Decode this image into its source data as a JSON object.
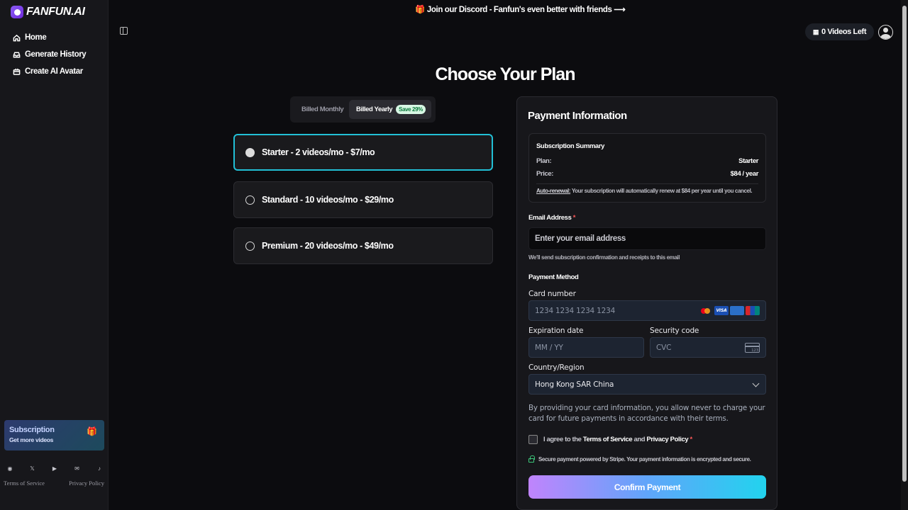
{
  "sidebar": {
    "logo": "FANFUN.AI",
    "items": [
      {
        "label": "Home",
        "icon": "home-icon"
      },
      {
        "label": "Generate History",
        "icon": "inbox-icon"
      },
      {
        "label": "Create AI Avatar",
        "icon": "film-icon"
      }
    ],
    "subscription": {
      "title": "Subscription",
      "subtitle": "Get more videos",
      "icon": "gift-icon"
    },
    "socials": [
      "discord-icon",
      "x-icon",
      "youtube-icon",
      "mail-icon",
      "tiktok-icon"
    ],
    "footer": {
      "terms": "Terms of Service",
      "privacy": "Privacy Policy"
    }
  },
  "header": {
    "banner": "Join our Discord - Fanfun's even better with friends ⟶",
    "videos_left": "0 Videos Left"
  },
  "main": {
    "title": "Choose Your Plan",
    "billing": {
      "monthly": "Billed Monthly",
      "yearly": "Billed Yearly",
      "save_badge": "Save 29%",
      "selected": "yearly"
    },
    "plans": [
      {
        "label": "Starter - 2 videos/mo - $7/mo",
        "selected": true
      },
      {
        "label": "Standard - 10 videos/mo - $29/mo",
        "selected": false
      },
      {
        "label": "Premium - 20 videos/mo - $49/mo",
        "selected": false
      }
    ]
  },
  "payment": {
    "title": "Payment Information",
    "summary": {
      "title": "Subscription Summary",
      "plan_label": "Plan:",
      "plan_value": "Starter",
      "price_label": "Price:",
      "price_value": "$84 / year",
      "renewal_label": "Auto-renewal:",
      "renewal_text": " Your subscription will automatically renew at $84 per year until you cancel."
    },
    "email_label": "Email Address",
    "required_mark": "*",
    "email_placeholder": "Enter your email address",
    "email_hint": "We'll send subscription confirmation and receipts to this email",
    "method_label": "Payment Method",
    "card_label": "Card number",
    "card_placeholder": "1234 1234 1234 1234",
    "card_brands": [
      "mastercard",
      "VISA",
      "AMEX",
      "UnionPay"
    ],
    "expiry_label": "Expiration date",
    "expiry_placeholder": "MM / YY",
    "cvc_label": "Security code",
    "cvc_placeholder": "CVC",
    "cvc_icon_text": "123",
    "country_label": "Country/Region",
    "country_value": "Hong Kong SAR China",
    "legal": "By providing your card information, you allow never to charge your card for future payments in accordance with their terms.",
    "agree_prefix": "I agree to the ",
    "agree_terms": "Terms of Service",
    "agree_and": " and ",
    "agree_privacy": "Privacy Policy",
    "secure_text": "Secure payment powered by Stripe. Your payment information is encrypted and secure.",
    "confirm_label": "Confirm Payment"
  },
  "colors": {
    "accent_border": "#22c0d6",
    "confirm_gradient": [
      "#c084fc",
      "#60a5fa",
      "#22d3ee"
    ],
    "save_badge_text": "#0c7a3c"
  }
}
